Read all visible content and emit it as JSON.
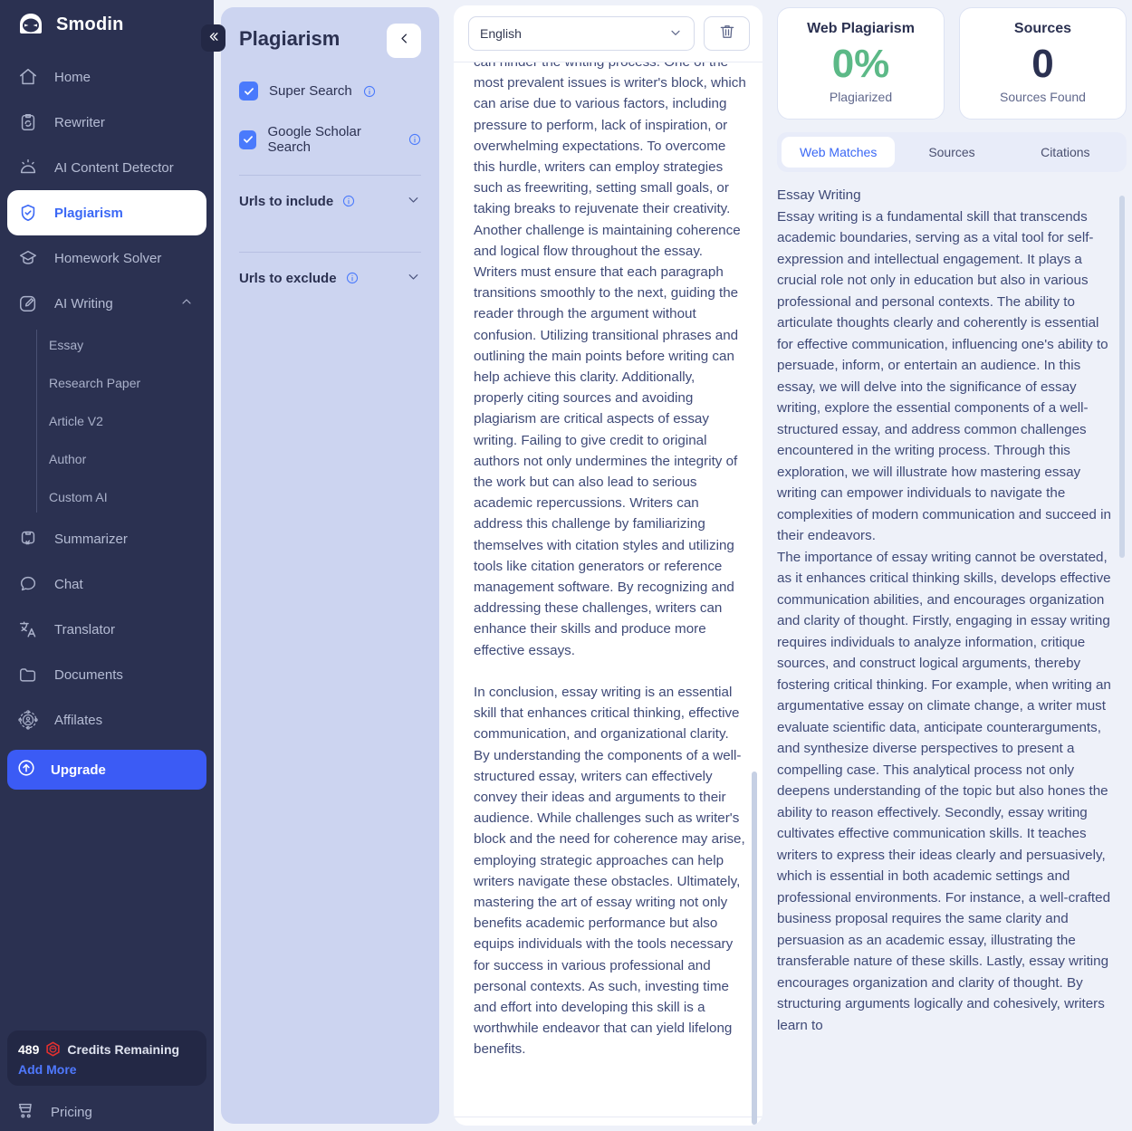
{
  "sidebar": {
    "brand": "Smodin",
    "collapse_icon": "double-chevron-left-icon",
    "items": [
      {
        "label": "Home",
        "icon": "home-icon"
      },
      {
        "label": "Rewriter",
        "icon": "rewrite-clipboard-icon"
      },
      {
        "label": "AI Content Detector",
        "icon": "detector-icon"
      },
      {
        "label": "Plagiarism",
        "icon": "shield-check-icon"
      },
      {
        "label": "Homework Solver",
        "icon": "graduation-cap-icon"
      },
      {
        "label": "AI Writing",
        "icon": "pencil-icon"
      }
    ],
    "ai_writing_children": [
      {
        "label": "Essay"
      },
      {
        "label": "Research Paper"
      },
      {
        "label": "Article V2"
      },
      {
        "label": "Author"
      },
      {
        "label": "Custom AI"
      }
    ],
    "items_after": [
      {
        "label": "Summarizer",
        "icon": "summarize-icon"
      },
      {
        "label": "Chat",
        "icon": "chat-bubble-icon"
      },
      {
        "label": "Translator",
        "icon": "translate-icon"
      },
      {
        "label": "Documents",
        "icon": "folder-icon"
      },
      {
        "label": "Affilates",
        "icon": "affiliates-network-icon"
      }
    ],
    "upgrade": {
      "label": "Upgrade",
      "icon": "upgrade-arrow-icon"
    },
    "credits": {
      "count": "489",
      "coin_icon": "credit-coin-icon",
      "label": "Credits Remaining",
      "add_more": "Add More"
    },
    "pricing": {
      "label": "Pricing",
      "icon": "cart-icon"
    },
    "active_item": "Plagiarism"
  },
  "options": {
    "title": "Plagiarism",
    "collapse_icon": "chevron-left-icon",
    "checkboxes": [
      {
        "label": "Super Search",
        "checked": true,
        "info_icon": "info-icon"
      },
      {
        "label": "Google Scholar Search",
        "checked": true,
        "info_icon": "info-icon"
      }
    ],
    "accordions": [
      {
        "label": "Urls to include",
        "info_icon": "info-icon",
        "chevron": "chevron-down-icon"
      },
      {
        "label": "Urls to exclude",
        "info_icon": "info-icon",
        "chevron": "chevron-down-icon"
      }
    ]
  },
  "editor": {
    "language": "English",
    "language_chevron": "chevron-down-icon",
    "delete_icon": "trash-icon",
    "paragraphs": [
      "can hinder the writing process. One of the most prevalent issues is writer's block, which can arise due to various factors, including pressure to perform, lack of inspiration, or overwhelming expectations. To overcome this hurdle, writers can employ strategies such as freewriting, setting small goals, or taking breaks to rejuvenate their creativity. Another challenge is maintaining coherence and logical flow throughout the essay. Writers must ensure that each paragraph transitions smoothly to the next, guiding the reader through the argument without confusion. Utilizing transitional phrases and outlining the main points before writing can help achieve this clarity. Additionally, properly citing sources and avoiding plagiarism are critical aspects of essay writing. Failing to give credit to original authors not only undermines the integrity of the work but can also lead to serious academic repercussions. Writers can address this challenge by familiarizing themselves with citation styles and utilizing tools like citation generators or reference management software. By recognizing and addressing these challenges, writers can enhance their skills and produce more effective essays.",
      "In conclusion, essay writing is an essential skill that enhances critical thinking, effective communication, and organizational clarity. By understanding the components of a well-structured essay, writers can effectively convey their ideas and arguments to their audience. While challenges such as writer's block and the need for coherence may arise, employing strategic approaches can help writers navigate these obstacles. Ultimately, mastering the art of essay writing not only benefits academic performance but also equips individuals with the tools necessary for success in various professional and personal contexts. As such, investing time and effort into developing this skill is a worthwhile endeavor that can yield lifelong benefits."
    ]
  },
  "results": {
    "stats": [
      {
        "title": "Web Plagiarism",
        "value": "0%",
        "sub": "Plagiarized",
        "color": "#5cb987"
      },
      {
        "title": "Sources",
        "value": "0",
        "sub": "Sources Found",
        "color": "#2b3151"
      }
    ],
    "tabs": [
      {
        "label": "Web Matches",
        "active": true
      },
      {
        "label": "Sources",
        "active": false
      },
      {
        "label": "Citations",
        "active": false
      }
    ],
    "match_title": "Essay Writing",
    "match_paragraphs": [
      "Essay writing is a fundamental skill that transcends academic boundaries, serving as a vital tool for self-expression and intellectual engagement. It plays a crucial role not only in education but also in various professional and personal contexts. The ability to articulate thoughts clearly and coherently is essential for effective communication, influencing one's ability to persuade, inform, or entertain an audience. In this essay, we will delve into the significance of essay writing, explore the essential components of a well-structured essay, and address common challenges encountered in the writing process. Through this exploration, we will illustrate how mastering essay writing can empower individuals to navigate the complexities of modern communication and succeed in their endeavors.",
      "The importance of essay writing cannot be overstated, as it enhances critical thinking skills, develops effective communication abilities, and encourages organization and clarity of thought. Firstly, engaging in essay writing requires individuals to analyze information, critique sources, and construct logical arguments, thereby fostering critical thinking. For example, when writing an argumentative essay on climate change, a writer must evaluate scientific data, anticipate counterarguments, and synthesize diverse perspectives to present a compelling case. This analytical process not only deepens understanding of the topic but also hones the ability to reason effectively. Secondly, essay writing cultivates effective communication skills. It teaches writers to express their ideas clearly and persuasively, which is essential in both academic settings and professional environments. For instance, a well-crafted business proposal requires the same clarity and persuasion as an academic essay, illustrating the transferable nature of these skills. Lastly, essay writing encourages organization and clarity of thought. By structuring arguments logically and cohesively, writers learn to"
    ]
  }
}
